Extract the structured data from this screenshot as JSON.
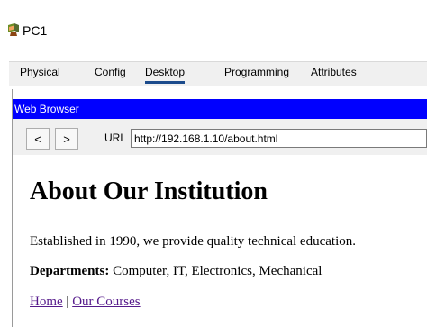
{
  "window": {
    "title": "PC1",
    "icon": "pc-device-icon"
  },
  "tabs": [
    {
      "label": "Physical",
      "active": false
    },
    {
      "label": "Config",
      "active": false
    },
    {
      "label": "Desktop",
      "active": true
    },
    {
      "label": "Programming",
      "active": false
    },
    {
      "label": "Attributes",
      "active": false
    }
  ],
  "browser": {
    "title": "Web Browser",
    "title_bar_color": "#0000ff",
    "back_label": "<",
    "forward_label": ">",
    "url_label": "URL",
    "url_value": "http://192.168.1.10/about.html"
  },
  "page": {
    "heading": "About Our Institution",
    "paragraph": "Established in 1990, we provide quality technical education.",
    "departments_label": "Departments:",
    "departments_value": " Computer, IT, Electronics, Mechanical",
    "links": [
      {
        "label": "Home"
      },
      {
        "label": "Our Courses"
      }
    ],
    "link_separator": " | ",
    "link_color": "#551a8b"
  }
}
